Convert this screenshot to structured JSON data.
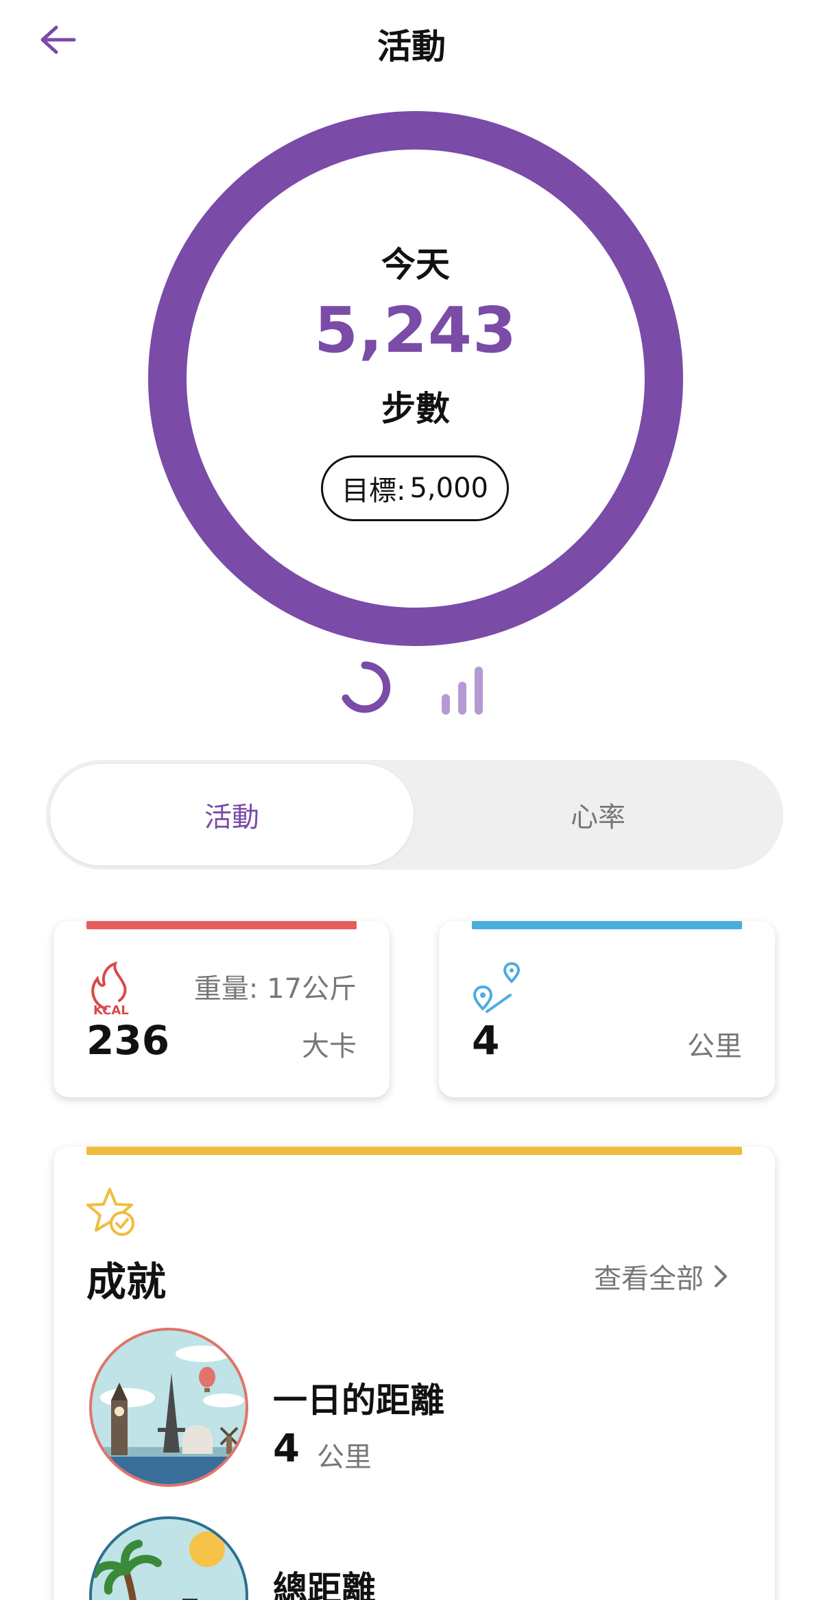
{
  "header": {
    "title": "活動",
    "back_icon": "arrow-left-icon"
  },
  "ring": {
    "today_label": "今天",
    "steps": "5,243",
    "steps_label": "步數",
    "goal_label": "目標:",
    "goal_value": "5,000",
    "progress_fraction": 1.0,
    "color": "#7a4ba7"
  },
  "view_toggles": {
    "ring_icon": "ring-chart-icon",
    "bar_icon": "bar-chart-icon"
  },
  "tabs": {
    "active": "活動",
    "inactive": "心率"
  },
  "stats": {
    "calories": {
      "icon": "kcal-flame-icon",
      "weight_label": "重量: 17公斤",
      "value": "236",
      "unit": "大卡",
      "bar_color": "#e85c5c"
    },
    "distance": {
      "icon": "route-pins-icon",
      "value": "4",
      "unit": "公里",
      "bar_color": "#4aaedc"
    }
  },
  "achievements": {
    "title": "成就",
    "view_all": "查看全部",
    "bar_color": "#f0bc3c",
    "items": [
      {
        "name": "一日的距離",
        "value": "4",
        "unit": "公里",
        "badge": "landmarks-badge"
      },
      {
        "name": "總距離",
        "badge": "island-badge"
      }
    ]
  }
}
